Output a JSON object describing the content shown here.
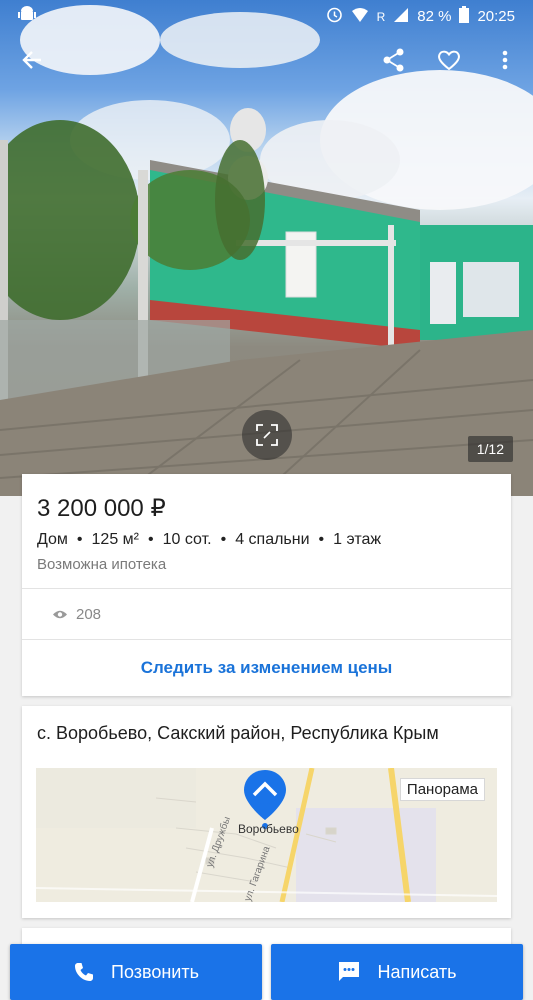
{
  "statusbar": {
    "battery": "82 %",
    "time": "20:25",
    "network_letter": "R"
  },
  "gallery": {
    "counter": "1/12"
  },
  "listing": {
    "price": "3 200 000 ₽",
    "params": [
      "Дом",
      "125 м²",
      "10 сот.",
      "4 спальни",
      "1 этаж"
    ],
    "mortgage": "Возможна ипотека",
    "views": "208",
    "track_price": "Следить за изменением цены"
  },
  "location": {
    "address": "с. Воробьево, Сакский район, Республика Крым",
    "panorama": "Панорама",
    "village_label": "Воробьево",
    "streets": [
      "ул. Дружбы",
      "ул. Гагарина"
    ]
  },
  "actions": {
    "call": "Позвонить",
    "write": "Написать"
  },
  "colors": {
    "accent": "#1a73e8",
    "link": "#1a73d9",
    "house_wall": "#2fb88c"
  }
}
